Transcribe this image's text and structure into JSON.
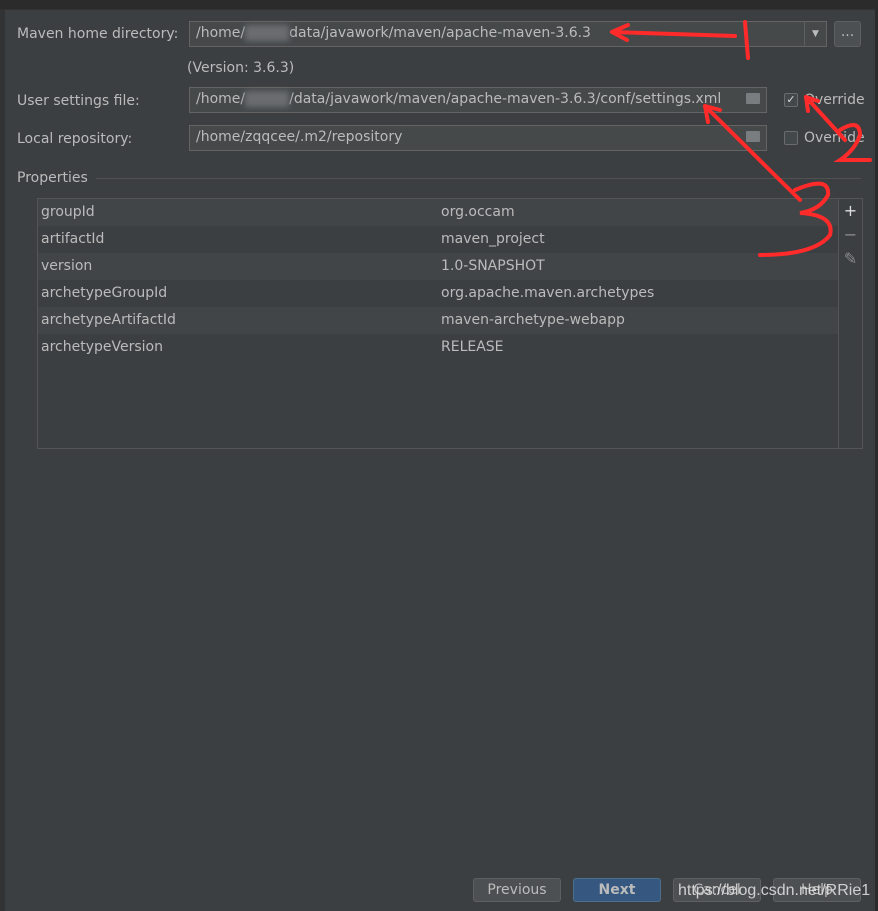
{
  "maven_home": {
    "label": "Maven home directory:",
    "prefix": "/home/",
    "suffix": "data/javawork/maven/apache-maven-3.6.3",
    "version": "(Version: 3.6.3)",
    "more_label": "...",
    "dropdown_icon": "triangle-down"
  },
  "user_settings": {
    "label": "User settings file:",
    "prefix": "/home/",
    "suffix": "/data/javawork/maven/apache-maven-3.6.3/conf/settings.xml",
    "override_label": "Override",
    "override_checked": true
  },
  "local_repo": {
    "label": "Local repository:",
    "value": "/home/zqqcee/.m2/repository",
    "override_label": "Override",
    "override_checked": false
  },
  "properties": {
    "title": "Properties",
    "rows": [
      {
        "key": "groupId",
        "value": "org.occam"
      },
      {
        "key": "artifactId",
        "value": "maven_project"
      },
      {
        "key": "version",
        "value": "1.0-SNAPSHOT"
      },
      {
        "key": "archetypeGroupId",
        "value": "org.apache.maven.archetypes"
      },
      {
        "key": "archetypeArtifactId",
        "value": "maven-archetype-webapp"
      },
      {
        "key": "archetypeVersion",
        "value": "RELEASE"
      }
    ],
    "tools": {
      "add": "+",
      "remove": "−",
      "edit": "✎"
    }
  },
  "buttons": {
    "previous": "Previous",
    "next": "Next",
    "cancel": "Cancel",
    "help": "Help"
  },
  "watermark": "https://blog.csdn.net/RRie1",
  "annotations": {
    "color": "#ff2a2a",
    "labels": [
      "1",
      "2",
      "3"
    ]
  }
}
